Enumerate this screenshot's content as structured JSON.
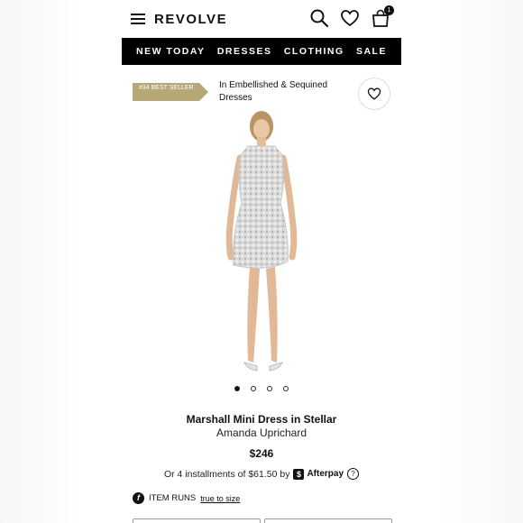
{
  "header": {
    "logo": "REVOLVE",
    "cart_count": "1",
    "icons": [
      "menu-icon",
      "search-icon",
      "heart-icon",
      "bag-icon"
    ]
  },
  "nav": {
    "items": [
      "NEW TODAY",
      "DRESSES",
      "CLOTHING",
      "SALE"
    ]
  },
  "badge": {
    "text": "#34 BEST SELLER",
    "category": "In Embellished & Sequined Dresses",
    "color": "#b6a776"
  },
  "gallery": {
    "dots": 4,
    "active_index": 0
  },
  "product": {
    "name": "Marshall Mini Dress in Stellar",
    "designer": "Amanda Uprichard",
    "price": "$246",
    "installments_text": "Or 4 installments of $61.50 by",
    "afterpay_label": "Afterpay"
  },
  "fit": {
    "label": "ITEM RUNS",
    "link": "true to size"
  }
}
